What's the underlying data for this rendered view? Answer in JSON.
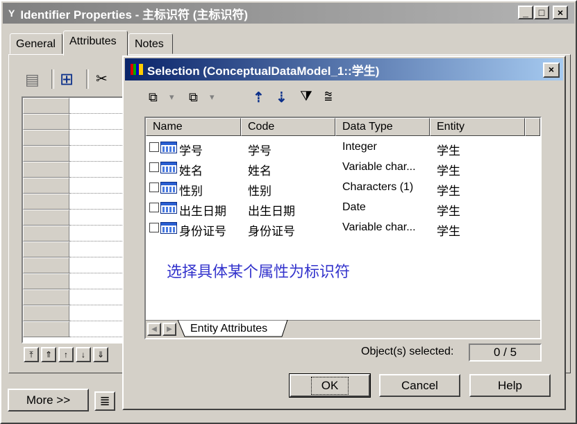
{
  "parent": {
    "title": "Identifier Properties - 主标识符 (主标识符)",
    "title_glyph": "Y",
    "caption_buttons": [
      "_",
      "□",
      "×"
    ],
    "tabs": [
      {
        "label": "General"
      },
      {
        "label": "Attributes"
      },
      {
        "label": "Notes"
      }
    ],
    "more_button": "More >>",
    "list_icon_glyph": "≣",
    "toolbar_glyphs": {
      "properties": "▤",
      "add_attributes": "⊞",
      "cut": "✂"
    },
    "row_nav": [
      "⤒",
      "⇑",
      "↑",
      "↓",
      "⇓"
    ]
  },
  "dialog": {
    "title": "Selection (ConceptualDataModel_1::学生)",
    "close_label": "×",
    "toolbar": [
      {
        "name": "select-all-icon",
        "glyph": "⧉"
      },
      {
        "name": "deselect-all-icon",
        "glyph": "⧉"
      },
      {
        "name": "move-top-icon",
        "glyph": "⇡"
      },
      {
        "name": "move-bottom-icon",
        "glyph": "⇣"
      },
      {
        "name": "filter-icon",
        "glyph": "⧩"
      },
      {
        "name": "clear-filter-icon",
        "glyph": "⩰"
      }
    ],
    "dropdown_glyph": "▾",
    "columns": [
      "Name",
      "Code",
      "Data Type",
      "Entity"
    ],
    "rows": [
      {
        "name": "学号",
        "code": "学号",
        "data_type": "Integer",
        "entity": "学生",
        "checked": false
      },
      {
        "name": "姓名",
        "code": "姓名",
        "data_type": "Variable char...",
        "entity": "学生",
        "checked": false
      },
      {
        "name": "性别",
        "code": "性别",
        "data_type": "Characters (1)",
        "entity": "学生",
        "checked": false
      },
      {
        "name": "出生日期",
        "code": "出生日期",
        "data_type": "Date",
        "entity": "学生",
        "checked": false
      },
      {
        "name": "身份证号",
        "code": "身份证号",
        "data_type": "Variable char...",
        "entity": "学生",
        "checked": false
      }
    ],
    "annotation": "选择具体某个属性为标识符",
    "annotation_color": "#3333cc",
    "sheet_tab": "Entity Attributes",
    "scroll_left": "◀",
    "scroll_right": "▶",
    "selected_label": "Object(s) selected:",
    "selected_value": "0 / 5",
    "buttons": {
      "ok": "OK",
      "cancel": "Cancel",
      "help": "Help"
    }
  },
  "colors": {
    "title_active": "#0a246a",
    "title_inactive": "#808080",
    "face": "#d4d0c8"
  }
}
